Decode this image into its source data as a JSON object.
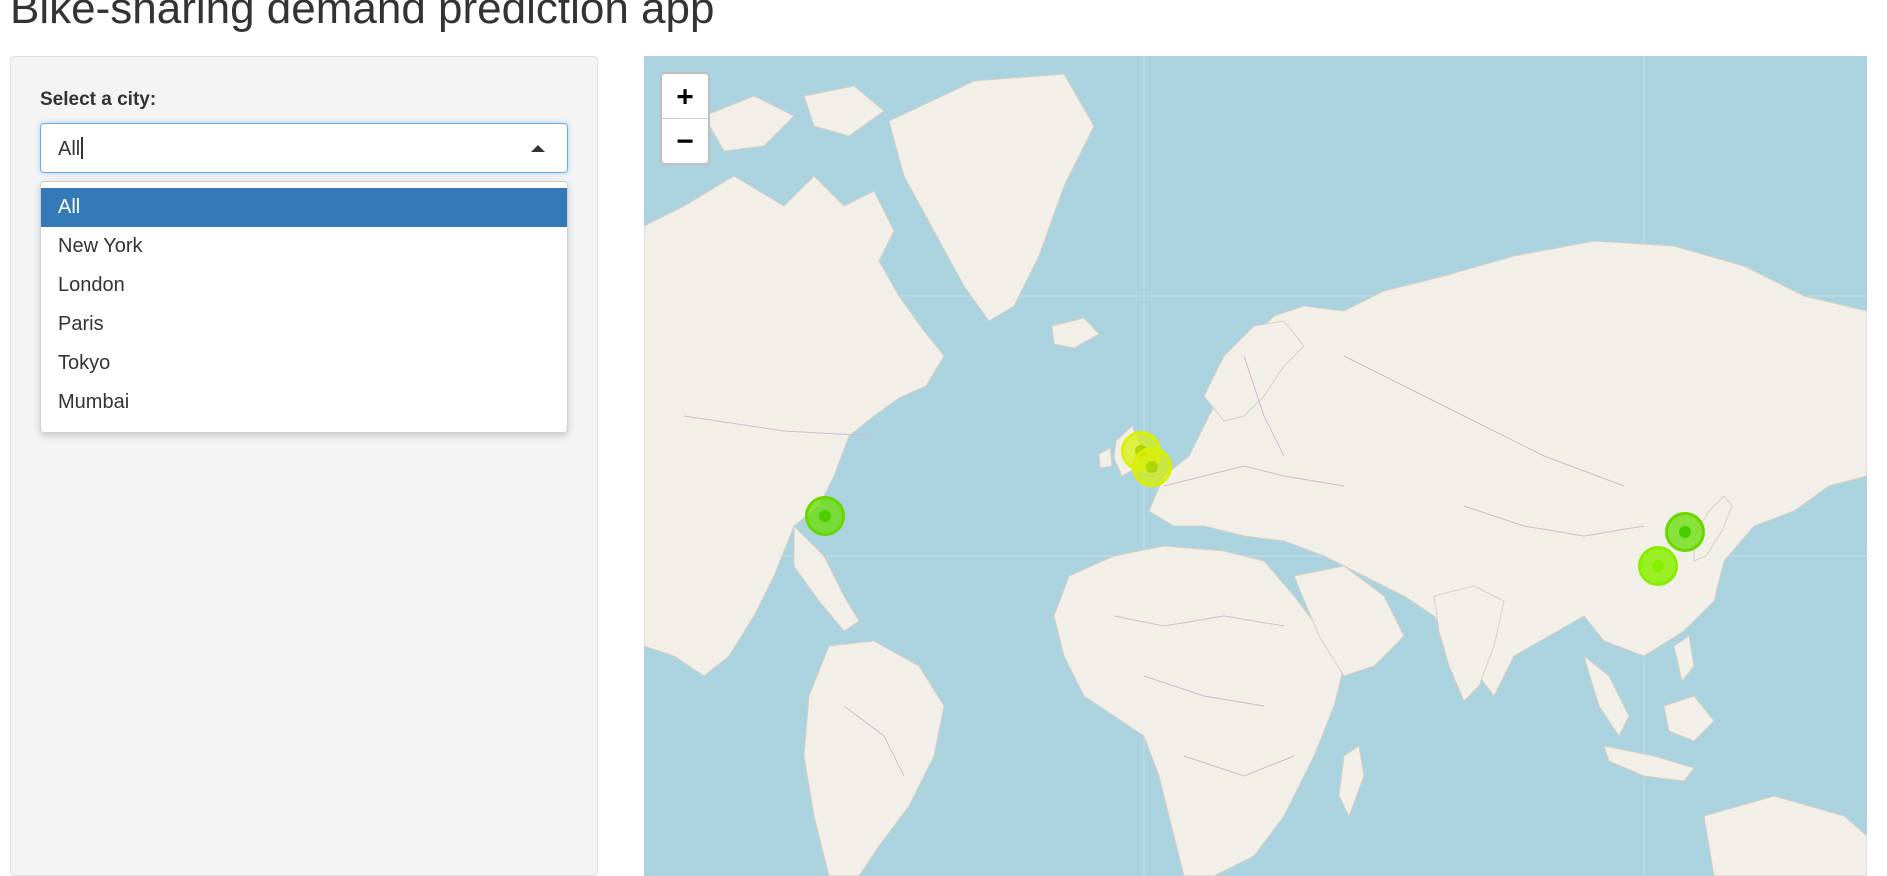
{
  "header": {
    "title": "Bike-sharing demand prediction app"
  },
  "sidebar": {
    "select_label": "Select a city:",
    "selected_value": "All",
    "options": [
      "All",
      "New York",
      "London",
      "Paris",
      "Tokyo",
      "Mumbai"
    ]
  },
  "map": {
    "zoom_in_label": "+",
    "zoom_out_label": "−",
    "markers": [
      {
        "city": "London",
        "color": "#d9f000"
      },
      {
        "city": "Paris",
        "color": "#d9f000"
      },
      {
        "city": "New York",
        "color": "#66dd00"
      },
      {
        "city": "Tokyo",
        "color": "#66dd00"
      },
      {
        "city": "Mumbai",
        "color": "#88ee00"
      }
    ]
  },
  "colors": {
    "selected_option_bg": "#337ab7",
    "water": "#aad3df",
    "land": "#f2efe9",
    "border": "#c8a8c8"
  }
}
